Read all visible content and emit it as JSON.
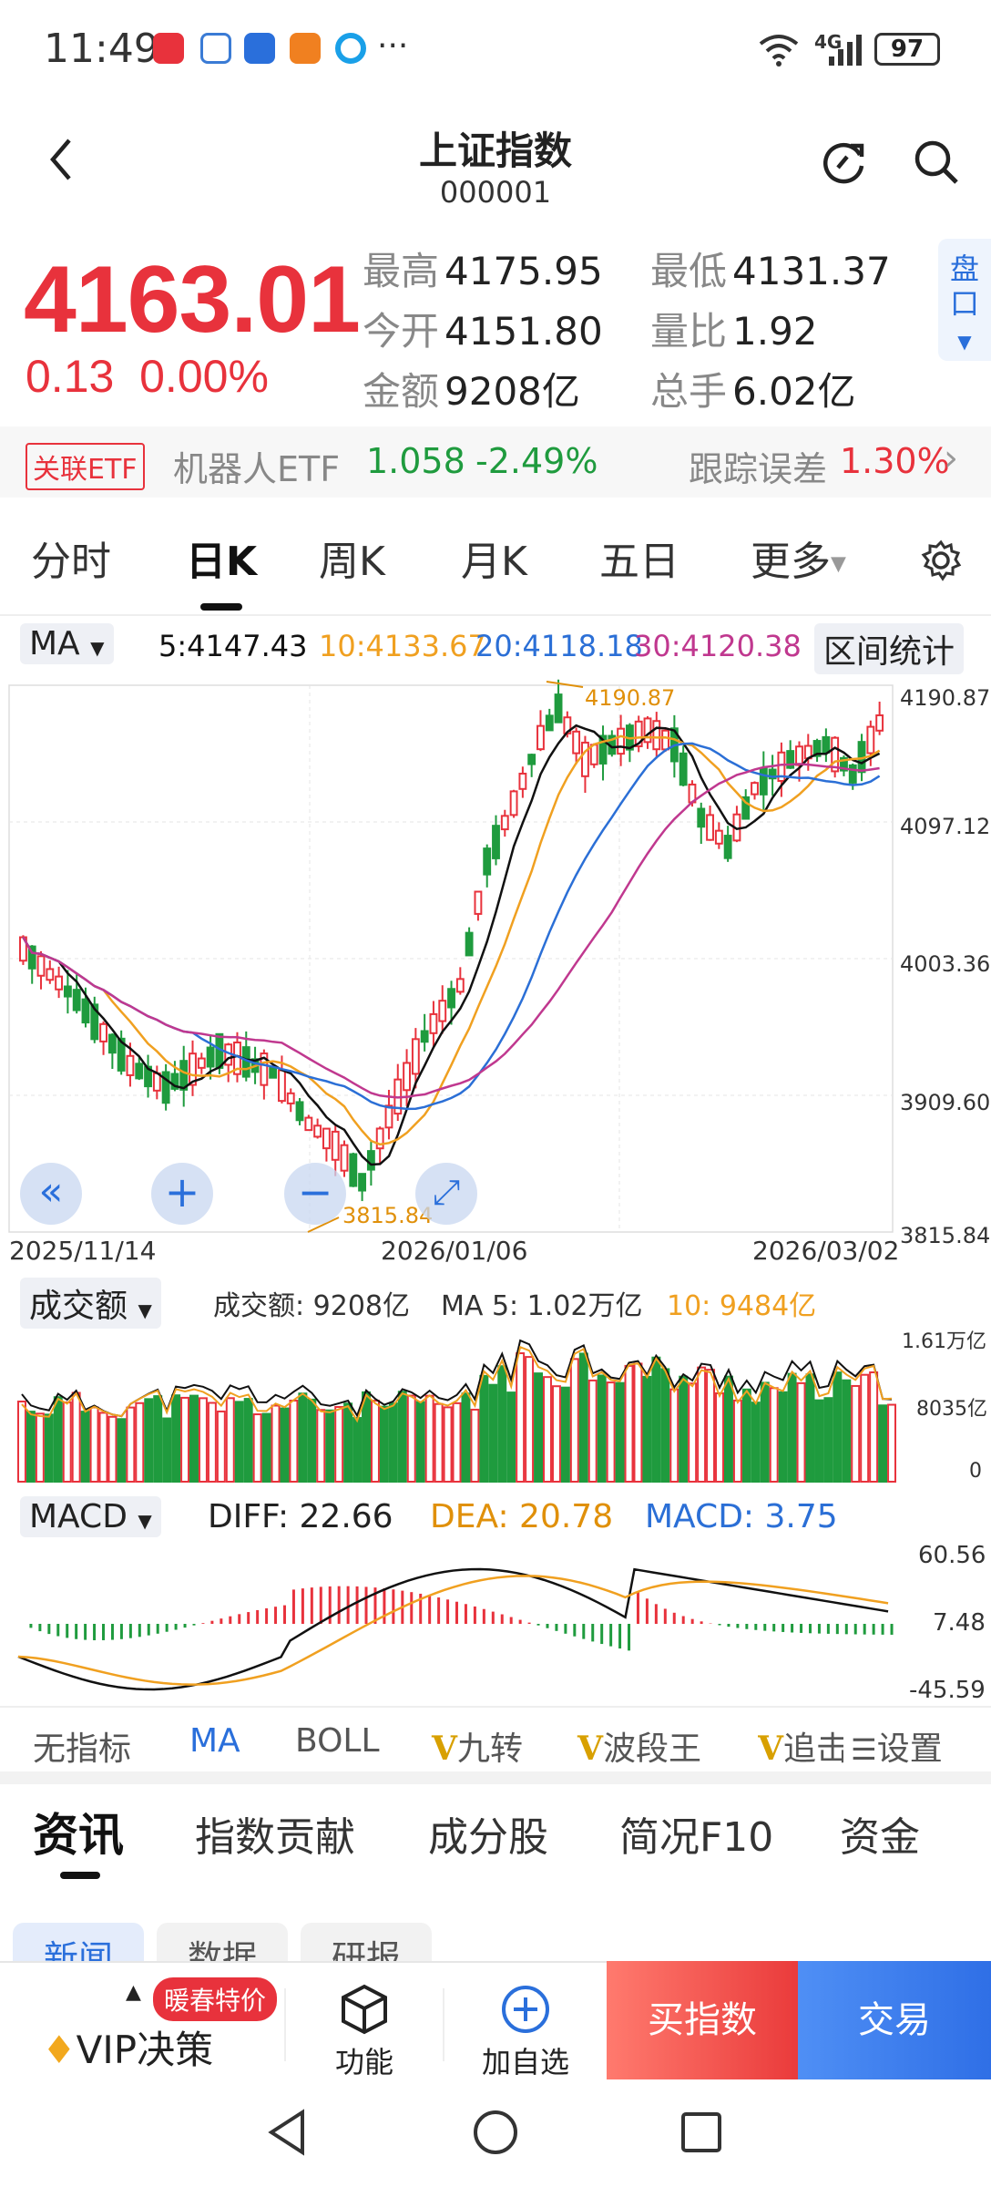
{
  "status": {
    "time": "11:49",
    "dots": "···",
    "signal": "6",
    "net": "4G",
    "battery": "97"
  },
  "header": {
    "title": "上证指数",
    "code": "000001"
  },
  "quote": {
    "price": "4163.01",
    "change": "0.13",
    "change_pct": "0.00%",
    "stats": [
      {
        "k": "最高",
        "v": "4175.95"
      },
      {
        "k": "最低",
        "v": "4131.37"
      },
      {
        "k": "今开",
        "v": "4151.80"
      },
      {
        "k": "量比",
        "v": "1.92"
      },
      {
        "k": "金额",
        "v": "9208亿"
      },
      {
        "k": "总手",
        "v": "6.02亿"
      }
    ],
    "pankou": "盘口"
  },
  "etf": {
    "tag": "关联ETF",
    "name": "机器人ETF",
    "price": "1.058",
    "pct": "-2.49%",
    "track_label": "跟踪误差",
    "track_val": "1.30%"
  },
  "period_tabs": [
    "分时",
    "日K",
    "周K",
    "月K",
    "五日",
    "更多"
  ],
  "ma": {
    "selector": "MA",
    "ma5": "5:4147.43",
    "ma10": "10:4133.67",
    "ma20": "20:4118.18",
    "ma30": "30:4120.38",
    "range_btn": "区间统计"
  },
  "kline": {
    "y_labels": [
      "4190.87",
      "4097.12",
      "4003.36",
      "3909.60",
      "3815.84"
    ],
    "high_label": "4190.87",
    "low_label": "3815.84",
    "x_labels": [
      "2025/11/14",
      "2026/01/06",
      "2026/03/02"
    ]
  },
  "volume": {
    "selector": "成交额",
    "label": "成交额: 9208亿",
    "ma5": "MA 5: 1.02万亿",
    "ma10": "10: 9484亿",
    "y_labels": [
      "1.61万亿",
      "8035亿",
      "0"
    ]
  },
  "macd": {
    "selector": "MACD",
    "diff": "DIFF: 22.66",
    "dea": "DEA: 20.78",
    "macd": "MACD: 3.75",
    "y_labels": [
      "60.56",
      "7.48",
      "-45.59"
    ]
  },
  "indicators": [
    "无指标",
    "MA",
    "BOLL",
    "九转",
    "波段王",
    "追击",
    "设置"
  ],
  "bottom_tabs": [
    "资讯",
    "指数贡献",
    "成分股",
    "简况F10",
    "资金"
  ],
  "sub_tabs": [
    "新闻",
    "数据",
    "研报"
  ],
  "toolbar": {
    "promo": "暖春特价",
    "vip": "VIP决策",
    "func": "功能",
    "add": "加自选",
    "buy": "买指数",
    "trade": "交易"
  },
  "colors": {
    "up": "#e8323c",
    "down": "#1f9b3e",
    "ma5": "#111111",
    "ma10": "#f0a020",
    "ma20": "#2b6fd6",
    "ma30": "#c0388f",
    "accent": "#2a6fdb"
  }
}
